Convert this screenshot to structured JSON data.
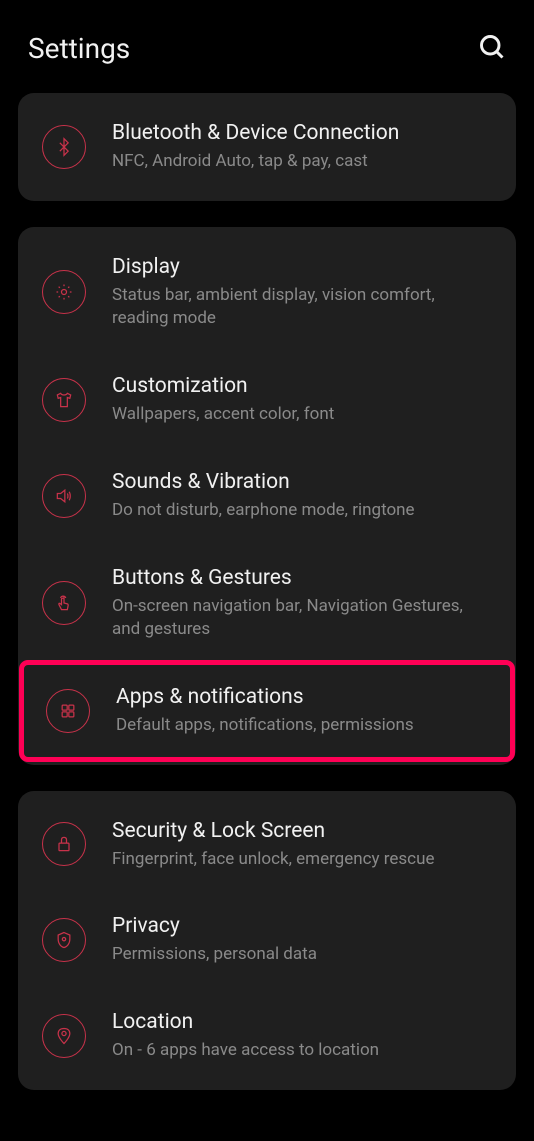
{
  "header": {
    "title": "Settings"
  },
  "sections": [
    {
      "items": [
        {
          "id": "bluetooth",
          "title": "Bluetooth & Device Connection",
          "subtitle": "NFC, Android Auto, tap & pay, cast"
        }
      ]
    },
    {
      "items": [
        {
          "id": "display",
          "title": "Display",
          "subtitle": "Status bar, ambient display, vision comfort, reading mode"
        },
        {
          "id": "customization",
          "title": "Customization",
          "subtitle": "Wallpapers, accent color, font"
        },
        {
          "id": "sounds",
          "title": "Sounds & Vibration",
          "subtitle": "Do not disturb, earphone mode, ringtone"
        },
        {
          "id": "buttons",
          "title": "Buttons & Gestures",
          "subtitle": "On-screen navigation bar, Navigation Gestures, and gestures"
        },
        {
          "id": "apps",
          "title": "Apps & notifications",
          "subtitle": "Default apps, notifications, permissions",
          "highlighted": true
        }
      ]
    },
    {
      "items": [
        {
          "id": "security",
          "title": "Security & Lock Screen",
          "subtitle": "Fingerprint, face unlock, emergency rescue"
        },
        {
          "id": "privacy",
          "title": "Privacy",
          "subtitle": "Permissions, personal data"
        },
        {
          "id": "location",
          "title": "Location",
          "subtitle": "On - 6 apps have access to location"
        }
      ]
    }
  ]
}
